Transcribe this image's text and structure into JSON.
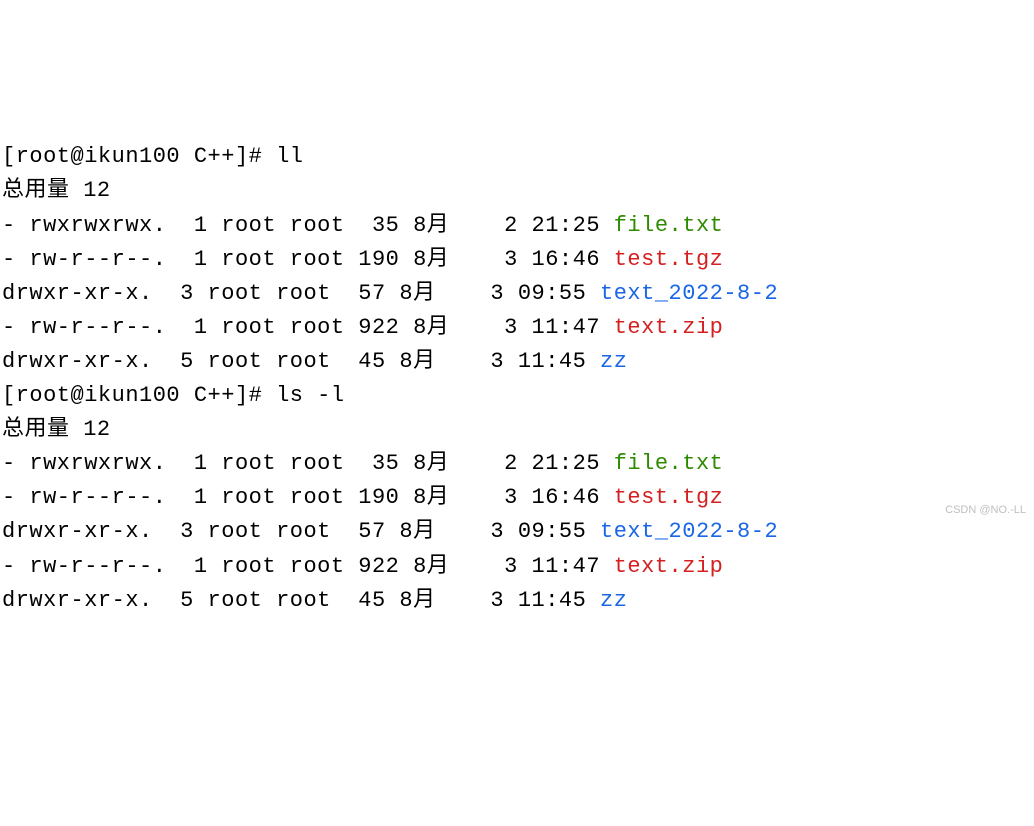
{
  "prompt1": {
    "open": "[",
    "user_host": "root@ikun100",
    "sep": " ",
    "cwd": "C++",
    "close": "]",
    "symbol": "#",
    "command": "ll"
  },
  "total1": "总用量 12",
  "listing1": {
    "rows": [
      {
        "perm": "- rwxrwxrwx.",
        "links": "1",
        "owner": "root",
        "group": "root",
        "size": " 35",
        "month": "8月",
        "day": " 2",
        "time": "21:25",
        "name": "file.txt",
        "name_class": "c-green"
      },
      {
        "perm": "- rw-r--r--.",
        "links": "1",
        "owner": "root",
        "group": "root",
        "size": "190",
        "month": "8月",
        "day": " 3",
        "time": "16:46",
        "name": "test.tgz",
        "name_class": "c-red"
      },
      {
        "perm": "drwxr-xr-x.",
        "links": "3",
        "owner": "root",
        "group": "root",
        "size": " 57",
        "month": "8月",
        "day": " 3",
        "time": "09:55",
        "name": "text_2022-8-2",
        "name_class": "c-blue"
      },
      {
        "perm": "- rw-r--r--.",
        "links": "1",
        "owner": "root",
        "group": "root",
        "size": "922",
        "month": "8月",
        "day": " 3",
        "time": "11:47",
        "name": "text.zip",
        "name_class": "c-red"
      },
      {
        "perm": "drwxr-xr-x.",
        "links": "5",
        "owner": "root",
        "group": "root",
        "size": " 45",
        "month": "8月",
        "day": " 3",
        "time": "11:45",
        "name": "zz",
        "name_class": "c-blue"
      }
    ]
  },
  "prompt2": {
    "open": "[",
    "user_host": "root@ikun100",
    "sep": " ",
    "cwd": "C++",
    "close": "]",
    "symbol": "#",
    "command": "ls -l"
  },
  "total2": "总用量 12",
  "listing2": {
    "rows": [
      {
        "perm": "- rwxrwxrwx.",
        "links": "1",
        "owner": "root",
        "group": "root",
        "size": " 35",
        "month": "8月",
        "day": " 2",
        "time": "21:25",
        "name": "file.txt",
        "name_class": "c-green"
      },
      {
        "perm": "- rw-r--r--.",
        "links": "1",
        "owner": "root",
        "group": "root",
        "size": "190",
        "month": "8月",
        "day": " 3",
        "time": "16:46",
        "name": "test.tgz",
        "name_class": "c-red"
      },
      {
        "perm": "drwxr-xr-x.",
        "links": "3",
        "owner": "root",
        "group": "root",
        "size": " 57",
        "month": "8月",
        "day": " 3",
        "time": "09:55",
        "name": "text_2022-8-2",
        "name_class": "c-blue"
      },
      {
        "perm": "- rw-r--r--.",
        "links": "1",
        "owner": "root",
        "group": "root",
        "size": "922",
        "month": "8月",
        "day": " 3",
        "time": "11:47",
        "name": "text.zip",
        "name_class": "c-red"
      },
      {
        "perm": "drwxr-xr-x.",
        "links": "5",
        "owner": "root",
        "group": "root",
        "size": " 45",
        "month": "8月",
        "day": " 3",
        "time": "11:45",
        "name": "zz",
        "name_class": "c-blue"
      }
    ]
  },
  "watermark": "CSDN @NO.-LL"
}
